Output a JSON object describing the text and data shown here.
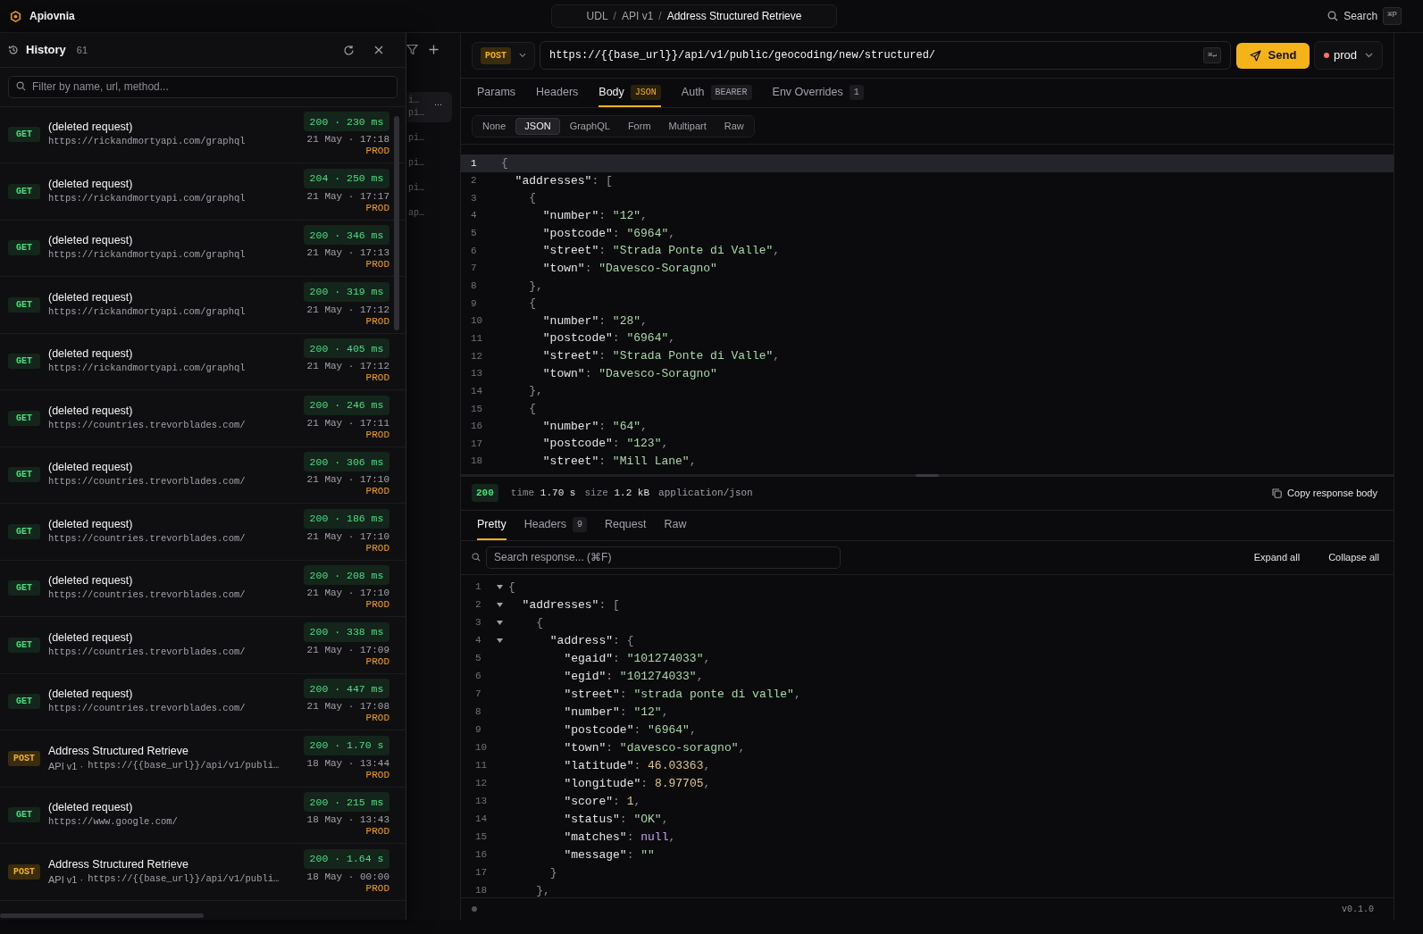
{
  "app": {
    "name": "Apiovnia"
  },
  "breadcrumb": [
    "UDL",
    "/",
    "API v1",
    "/",
    "Address Structured Retrieve"
  ],
  "search": {
    "label": "Search",
    "shortcut": "⌘P"
  },
  "history": {
    "title": "History",
    "count": "61",
    "filter_placeholder": "Filter by name, url, method...",
    "rows": [
      {
        "method": "GET",
        "title": "(deleted request)",
        "url": "https://rickandmortyapi.com/graphql",
        "status": "200 · 230 ms",
        "date": "21 May · 17:18",
        "env": "PROD"
      },
      {
        "method": "GET",
        "title": "(deleted request)",
        "url": "https://rickandmortyapi.com/graphql",
        "status": "204 · 250 ms",
        "date": "21 May · 17:17",
        "env": "PROD"
      },
      {
        "method": "GET",
        "title": "(deleted request)",
        "url": "https://rickandmortyapi.com/graphql",
        "status": "200 · 346 ms",
        "date": "21 May · 17:13",
        "env": "PROD"
      },
      {
        "method": "GET",
        "title": "(deleted request)",
        "url": "https://rickandmortyapi.com/graphql",
        "status": "200 · 319 ms",
        "date": "21 May · 17:12",
        "env": "PROD"
      },
      {
        "method": "GET",
        "title": "(deleted request)",
        "url": "https://rickandmortyapi.com/graphql",
        "status": "200 · 405 ms",
        "date": "21 May · 17:12",
        "env": "PROD"
      },
      {
        "method": "GET",
        "title": "(deleted request)",
        "url": "https://countries.trevorblades.com/",
        "status": "200 · 246 ms",
        "date": "21 May · 17:11",
        "env": "PROD"
      },
      {
        "method": "GET",
        "title": "(deleted request)",
        "url": "https://countries.trevorblades.com/",
        "status": "200 · 306 ms",
        "date": "21 May · 17:10",
        "env": "PROD"
      },
      {
        "method": "GET",
        "title": "(deleted request)",
        "url": "https://countries.trevorblades.com/",
        "status": "200 · 186 ms",
        "date": "21 May · 17:10",
        "env": "PROD"
      },
      {
        "method": "GET",
        "title": "(deleted request)",
        "url": "https://countries.trevorblades.com/",
        "status": "200 · 208 ms",
        "date": "21 May · 17:10",
        "env": "PROD"
      },
      {
        "method": "GET",
        "title": "(deleted request)",
        "url": "https://countries.trevorblades.com/",
        "status": "200 · 338 ms",
        "date": "21 May · 17:09",
        "env": "PROD"
      },
      {
        "method": "GET",
        "title": "(deleted request)",
        "url": "https://countries.trevorblades.com/",
        "status": "200 · 447 ms",
        "date": "21 May · 17:08",
        "env": "PROD"
      },
      {
        "method": "POST",
        "title": "Address Structured Retrieve",
        "project": "API v1 ·",
        "url": "https://{{base_url}}/api/v1/publi…",
        "status": "200 · 1.70 s",
        "date": "18 May · 13:44",
        "env": "PROD"
      },
      {
        "method": "GET",
        "title": "(deleted request)",
        "url": "https://www.google.com/",
        "status": "200 · 215 ms",
        "date": "18 May · 13:43",
        "env": "PROD"
      },
      {
        "method": "POST",
        "title": "Address Structured Retrieve",
        "project": "API v1 ·",
        "url": "https://{{base_url}}/api/v1/publi…",
        "status": "200 · 1.64 s",
        "date": "18 May · 00:00",
        "env": "PROD"
      }
    ]
  },
  "behind_sidebar": {
    "items": [
      {
        "lines": [
          "i…",
          "pi…"
        ],
        "selected": true
      },
      {
        "lines": [
          "pi…"
        ],
        "selected": false
      },
      {
        "lines": [
          "pi…"
        ],
        "selected": false
      },
      {
        "lines": [
          "pi…"
        ],
        "selected": false
      },
      {
        "lines": [
          "ap…"
        ],
        "selected": false
      }
    ],
    "menu": "..."
  },
  "request": {
    "method": "POST",
    "url": "https://{{base_url}}/api/v1/public/geocoding/new/structured/",
    "url_shortcut": "⌘↵",
    "send": "Send",
    "environment": "prod",
    "tabs": [
      {
        "label": "Params",
        "selected": false
      },
      {
        "label": "Headers",
        "selected": false
      },
      {
        "label": "Body",
        "badge": "JSON",
        "selected": true
      },
      {
        "label": "Auth",
        "badge": "BEARER",
        "selected": false
      },
      {
        "label": "Env Overrides",
        "badge": "1",
        "selected": false
      }
    ],
    "body_types": [
      {
        "label": "None",
        "selected": false
      },
      {
        "label": "JSON",
        "selected": true
      },
      {
        "label": "GraphQL",
        "selected": false
      },
      {
        "label": "Form",
        "selected": false
      },
      {
        "label": "Multipart",
        "selected": false
      },
      {
        "label": "Raw",
        "selected": false
      }
    ],
    "lines": [
      {
        "n": "1",
        "text": "{",
        "current": true
      },
      {
        "n": "2",
        "text": "  \"addresses\": [",
        "current": false
      },
      {
        "n": "3",
        "text": "    {",
        "current": false
      },
      {
        "n": "4",
        "text": "      \"number\": \"12\",",
        "current": false
      },
      {
        "n": "5",
        "text": "      \"postcode\": \"6964\",",
        "current": false
      },
      {
        "n": "6",
        "text": "      \"street\": \"Strada Ponte di Valle\",",
        "current": false
      },
      {
        "n": "7",
        "text": "      \"town\": \"Davesco-Soragno\"",
        "current": false
      },
      {
        "n": "8",
        "text": "    },",
        "current": false
      },
      {
        "n": "9",
        "text": "    {",
        "current": false
      },
      {
        "n": "10",
        "text": "      \"number\": \"28\",",
        "current": false
      },
      {
        "n": "11",
        "text": "      \"postcode\": \"6964\",",
        "current": false
      },
      {
        "n": "12",
        "text": "      \"street\": \"Strada Ponte di Valle\",",
        "current": false
      },
      {
        "n": "13",
        "text": "      \"town\": \"Davesco-Soragno\"",
        "current": false
      },
      {
        "n": "14",
        "text": "    },",
        "current": false
      },
      {
        "n": "15",
        "text": "    {",
        "current": false
      },
      {
        "n": "16",
        "text": "      \"number\": \"64\",",
        "current": false
      },
      {
        "n": "17",
        "text": "      \"postcode\": \"123\",",
        "current": false
      },
      {
        "n": "18",
        "text": "      \"street\": \"Mill Lane\",",
        "current": false
      }
    ]
  },
  "response": {
    "status": "200",
    "time_label": "time",
    "time": "1.70 s",
    "size_label": "size",
    "size": "1.2 kB",
    "content_type": "application/json",
    "copy": "Copy response body",
    "tabs": [
      {
        "label": "Pretty",
        "selected": true
      },
      {
        "label": "Headers",
        "badge": "9",
        "selected": false
      },
      {
        "label": "Request",
        "selected": false
      },
      {
        "label": "Raw",
        "selected": false
      }
    ],
    "search_placeholder": "Search response... (⌘F)",
    "expand": "Expand all",
    "collapse": "Collapse all",
    "lines": [
      {
        "n": "1",
        "text": "{",
        "collapsible": true
      },
      {
        "n": "2",
        "text": "  \"addresses\": [",
        "collapsible": true
      },
      {
        "n": "3",
        "text": "    {",
        "collapsible": true
      },
      {
        "n": "4",
        "text": "      \"address\": {",
        "collapsible": true
      },
      {
        "n": "5",
        "text": "        \"egaid\": \"101274033\",",
        "collapsible": false
      },
      {
        "n": "6",
        "text": "        \"egid\": \"101274033\",",
        "collapsible": false
      },
      {
        "n": "7",
        "text": "        \"street\": \"strada ponte di valle\",",
        "collapsible": false
      },
      {
        "n": "8",
        "text": "        \"number\": \"12\",",
        "collapsible": false
      },
      {
        "n": "9",
        "text": "        \"postcode\": \"6964\",",
        "collapsible": false
      },
      {
        "n": "10",
        "text": "        \"town\": \"davesco-soragno\",",
        "collapsible": false
      },
      {
        "n": "11",
        "text": "        \"latitude\": 46.03363,",
        "collapsible": false
      },
      {
        "n": "12",
        "text": "        \"longitude\": 8.97705,",
        "collapsible": false
      },
      {
        "n": "13",
        "text": "        \"score\": 1,",
        "collapsible": false
      },
      {
        "n": "14",
        "text": "        \"status\": \"OK\",",
        "collapsible": false
      },
      {
        "n": "15",
        "text": "        \"matches\": null,",
        "collapsible": false
      },
      {
        "n": "16",
        "text": "        \"message\": \"\"",
        "collapsible": false
      },
      {
        "n": "17",
        "text": "      }",
        "collapsible": false
      },
      {
        "n": "18",
        "text": "    },",
        "collapsible": false
      }
    ]
  },
  "footer": {
    "version": "v0.1.0"
  }
}
